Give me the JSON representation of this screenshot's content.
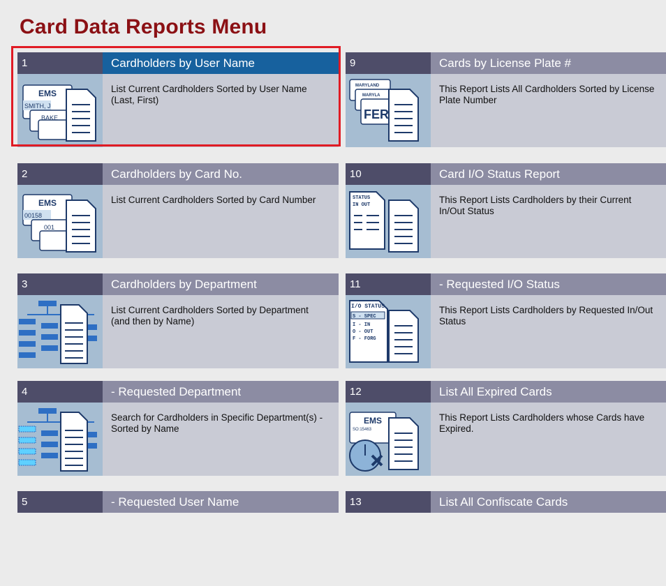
{
  "page": {
    "title": "Card Data Reports Menu"
  },
  "reports": [
    {
      "num": "1",
      "title": "Cardholders by User Name",
      "desc": "List Current Cardholders Sorted by User Name (Last, First)",
      "icon": "cardholder-card-icon",
      "selected": true
    },
    {
      "num": "2",
      "title": "Cardholders by Card No.",
      "desc": "List Current Cardholders Sorted by Card Number",
      "icon": "card-number-icon"
    },
    {
      "num": "3",
      "title": "Cardholders by Department",
      "desc": "List Current Cardholders Sorted by Department (and then by Name)",
      "icon": "department-tree-icon"
    },
    {
      "num": "4",
      "title": "- Requested Department",
      "desc": "Search for Cardholders in Specific Department(s) - Sorted by Name",
      "icon": "department-search-icon"
    },
    {
      "num": "5",
      "title": "- Requested User Name",
      "desc": "",
      "icon": ""
    },
    {
      "num": "9",
      "title": "Cards by License Plate #",
      "desc": "This Report Lists All Cardholders Sorted by License Plate Number",
      "icon": "license-plate-icon"
    },
    {
      "num": "10",
      "title": "Card I/O Status Report",
      "desc": "This Report Lists Cardholders by their Current In/Out Status",
      "icon": "io-status-icon"
    },
    {
      "num": "11",
      "title": "- Requested I/O Status",
      "desc": "This Report Lists Cardholders by Requested In/Out Status",
      "icon": "requested-io-status-icon"
    },
    {
      "num": "12",
      "title": "List All Expired Cards",
      "desc": "This Report Lists Cardholders whose Cards have Expired.",
      "icon": "expired-card-icon"
    },
    {
      "num": "13",
      "title": "List All Confiscate Cards",
      "desc": "",
      "icon": ""
    }
  ],
  "icon_text": {
    "ems": "EMS",
    "smith": "SMITH, J",
    "bake": "BAKE",
    "card_no_a": "00158",
    "card_no_b": "001",
    "maryland": "MARYLAND",
    "marylan2": "MARYLA",
    "fer": "FER",
    "status": "STATUS",
    "in_out": "IN  OUT",
    "io_status": "I/O STATUS",
    "spec": "S - SPEC",
    "in": "I - IN",
    "out": "O - OUT",
    "forg": "F - FORG",
    "so_no": "SO:15463"
  },
  "colors": {
    "title": "#8b1014",
    "num_bg": "#4e4d69",
    "title_bg": "#8c8ca3",
    "selected_title_bg": "#17619e",
    "body_bg": "#c9cbd5",
    "thumb_bg": "#a6bdd2",
    "highlight": "#e01b24"
  }
}
